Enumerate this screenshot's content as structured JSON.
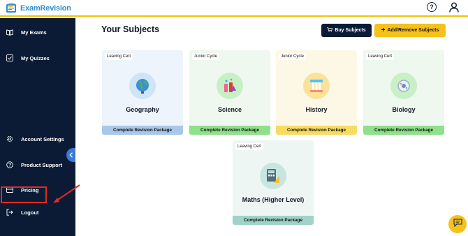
{
  "app": {
    "brand": "ExamRevision"
  },
  "sidebar": {
    "items": [
      {
        "label": "My Exams",
        "icon": "book-icon"
      },
      {
        "label": "My Quizzes",
        "icon": "checkbox-icon"
      },
      {
        "label": "Account Settings",
        "icon": "gear-icon"
      },
      {
        "label": "Product Support",
        "icon": "help-icon"
      },
      {
        "label": "Pricing",
        "icon": "card-icon"
      },
      {
        "label": "Logout",
        "icon": "logout-icon"
      }
    ]
  },
  "header": {
    "title": "Your Subjects",
    "buy_label": "Buy Subjects",
    "add_label": "Add/Remove Subjects"
  },
  "subjects": [
    {
      "tag": "Leaving Cert",
      "name": "Geography",
      "footer": "Complete Revision Package",
      "bg": "#eef4fb",
      "footer_bg": "#a9c7ea"
    },
    {
      "tag": "Junior Cycle",
      "name": "Science",
      "footer": "Complete Revision Package",
      "bg": "#eef8ee",
      "footer_bg": "#8fe08a"
    },
    {
      "tag": "Junior Cycle",
      "name": "History",
      "footer": "Complete Revision Package",
      "bg": "#fdf8e6",
      "footer_bg": "#f8dc62"
    },
    {
      "tag": "Leaving Cert",
      "name": "Biology",
      "footer": "Complete Revision Package",
      "bg": "#eef8ee",
      "footer_bg": "#8fe08a"
    },
    {
      "tag": "Leaving Cert",
      "name": "Maths (Higher Level)",
      "footer": "Complete Revision Package",
      "bg": "#eef6f4",
      "footer_bg": "#9fd3c7"
    }
  ],
  "colors": {
    "sidebar_bg": "#0b1b35",
    "accent_yellow": "#f6c21a",
    "brand_blue": "#2b8fd6",
    "highlight_red": "#e02b20"
  }
}
